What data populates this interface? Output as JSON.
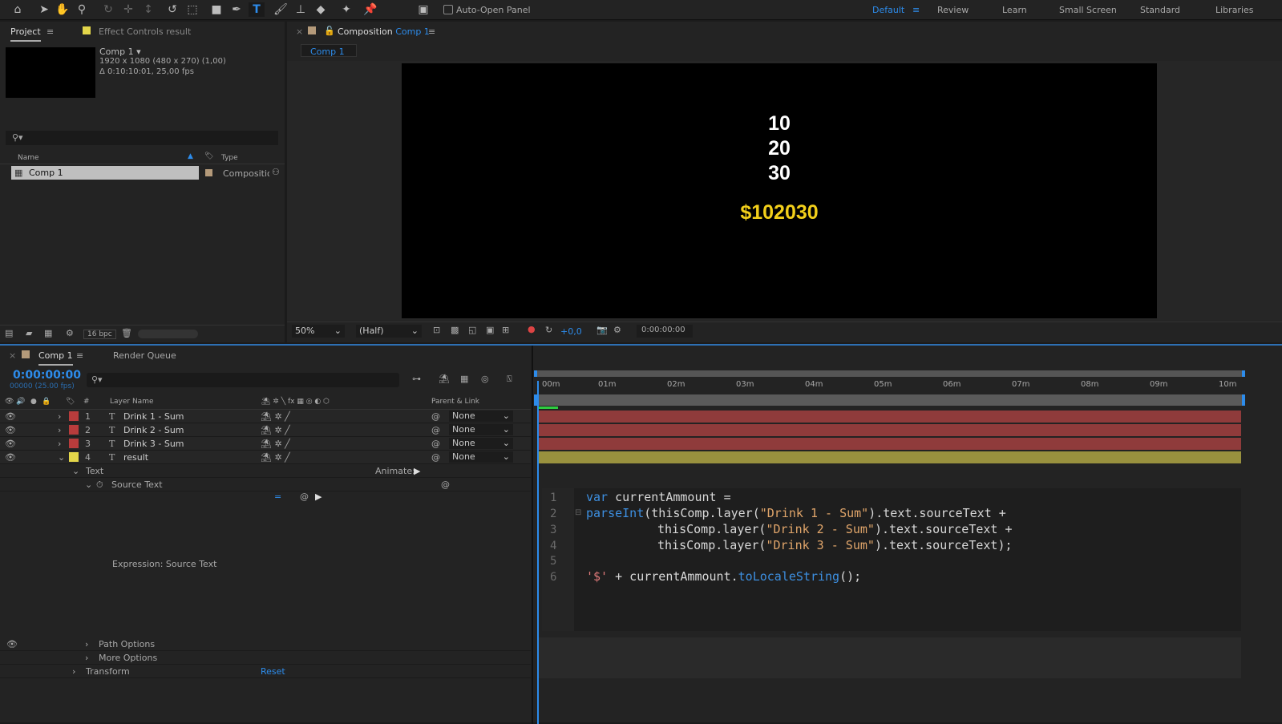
{
  "toolbar": {
    "auto_open_label": "Auto-Open Panel",
    "workspaces": [
      "Default",
      "Review",
      "Learn",
      "Small Screen",
      "Standard",
      "Libraries"
    ]
  },
  "project": {
    "tab": "Project",
    "effect_tab": "Effect Controls result",
    "comp_name": "Comp 1",
    "comp_info1": "1920 x 1080  (480 x 270) (1,00)",
    "comp_info2": "Δ 0:10:10:01, 25,00 fps",
    "col_name": "Name",
    "col_type": "Type",
    "item_name": "Comp 1",
    "item_type": "Composition",
    "bpc": "16 bpc"
  },
  "composition": {
    "tab_prefix": "Composition",
    "tab_name": "Comp 1",
    "subtab": "Comp 1",
    "lines": [
      "10",
      "20",
      "30"
    ],
    "result": "$102030",
    "zoom": "50%",
    "resolution": "(Half)",
    "exposure": "+0,0",
    "timecode": "0:00:00:00"
  },
  "timeline": {
    "tab": "Comp 1",
    "render_queue": "Render Queue",
    "time": "0:00:00:00",
    "frames": "00000 (25.00 fps)",
    "col_num": "#",
    "col_layer": "Layer Name",
    "col_parent": "Parent & Link",
    "ruler": [
      "00m",
      "01m",
      "02m",
      "03m",
      "04m",
      "05m",
      "06m",
      "07m",
      "08m",
      "09m",
      "10m"
    ],
    "layers": [
      {
        "num": "1",
        "name": "Drink 1 - Sum",
        "color": "#b83c3c",
        "parent": "None"
      },
      {
        "num": "2",
        "name": "Drink 2 - Sum",
        "color": "#b83c3c",
        "parent": "None"
      },
      {
        "num": "3",
        "name": "Drink 3 - Sum",
        "color": "#b83c3c",
        "parent": "None"
      },
      {
        "num": "4",
        "name": "result",
        "color": "#e3d64a",
        "parent": "None"
      }
    ],
    "text_label": "Text",
    "animate": "Animate:",
    "source_text": "Source Text",
    "expression_label": "Expression: Source Text",
    "path_options": "Path Options",
    "more_options": "More Options",
    "transform": "Transform",
    "reset": "Reset"
  },
  "code": {
    "line_numbers": [
      "1",
      "2",
      "3",
      "4",
      "5",
      "6"
    ],
    "l1a": "var",
    "l1b": " currentAmmount =",
    "l2a": "parseInt",
    "l2b": "(thisComp.layer(",
    "l2c": "\"Drink 1 - Sum\"",
    "l2d": ").text.sourceText +",
    "l3b": "thisComp.layer(",
    "l3c": "\"Drink 2 - Sum\"",
    "l3d": ").text.sourceText +",
    "l4b": "thisComp.layer(",
    "l4c": "\"Drink 3 - Sum\"",
    "l4d": ").text.sourceText);",
    "l6a": "'$'",
    "l6b": " + currentAmmount.",
    "l6c": "toLocaleString",
    "l6d": "();"
  }
}
